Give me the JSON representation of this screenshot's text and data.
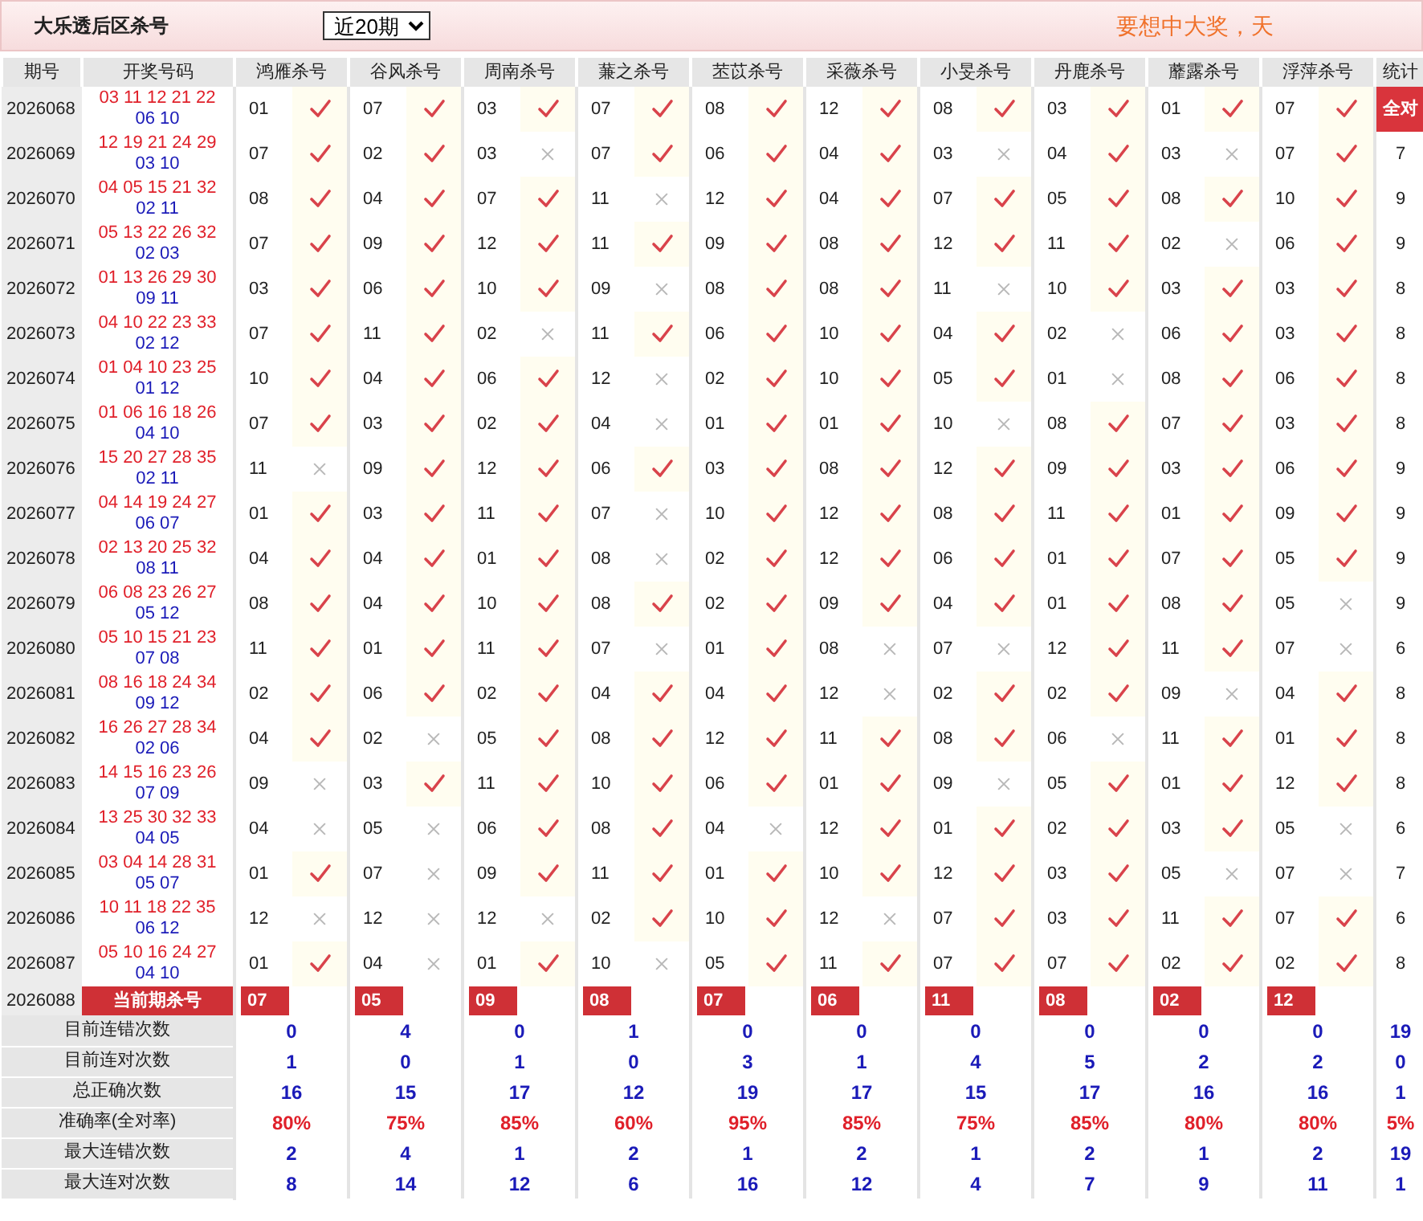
{
  "header": {
    "title": "大乐透后区杀号",
    "period_select": {
      "value": "近20期"
    },
    "slogan": "要想中大奖，天"
  },
  "table": {
    "columns": [
      "期号",
      "开奖号码",
      "鸿雁杀号",
      "谷风杀号",
      "周南杀号",
      "蒹之杀号",
      "苤苡杀号",
      "采薇杀号",
      "小旻杀号",
      "丹鹿杀号",
      "蘼露杀号",
      "浮萍杀号",
      "统计"
    ],
    "rows": [
      {
        "period": "2026068",
        "front": "03 11 12 21 22",
        "back": "06 10",
        "kills": [
          {
            "number": "01",
            "hit": true
          },
          {
            "number": "07",
            "hit": true
          },
          {
            "number": "03",
            "hit": true
          },
          {
            "number": "07",
            "hit": true
          },
          {
            "number": "08",
            "hit": true
          },
          {
            "number": "12",
            "hit": true
          },
          {
            "number": "08",
            "hit": true
          },
          {
            "number": "03",
            "hit": true
          },
          {
            "number": "01",
            "hit": true
          },
          {
            "number": "07",
            "hit": true
          }
        ],
        "total": {
          "text": "全对",
          "kind": "badge"
        }
      },
      {
        "period": "2026069",
        "front": "12 19 21 24 29",
        "back": "03 10",
        "kills": [
          {
            "number": "07",
            "hit": true
          },
          {
            "number": "02",
            "hit": true
          },
          {
            "number": "03",
            "hit": false
          },
          {
            "number": "07",
            "hit": true
          },
          {
            "number": "06",
            "hit": true
          },
          {
            "number": "04",
            "hit": true
          },
          {
            "number": "03",
            "hit": false
          },
          {
            "number": "04",
            "hit": true
          },
          {
            "number": "03",
            "hit": false
          },
          {
            "number": "07",
            "hit": true
          }
        ],
        "total": {
          "text": "7",
          "kind": "plain"
        }
      },
      {
        "period": "2026070",
        "front": "04 05 15 21 32",
        "back": "02 11",
        "kills": [
          {
            "number": "08",
            "hit": true
          },
          {
            "number": "04",
            "hit": true
          },
          {
            "number": "07",
            "hit": true
          },
          {
            "number": "11",
            "hit": false
          },
          {
            "number": "12",
            "hit": true
          },
          {
            "number": "04",
            "hit": true
          },
          {
            "number": "07",
            "hit": true
          },
          {
            "number": "05",
            "hit": true
          },
          {
            "number": "08",
            "hit": true
          },
          {
            "number": "10",
            "hit": true
          }
        ],
        "total": {
          "text": "9",
          "kind": "plain"
        }
      },
      {
        "period": "2026071",
        "front": "05 13 22 26 32",
        "back": "02 03",
        "kills": [
          {
            "number": "07",
            "hit": true
          },
          {
            "number": "09",
            "hit": true
          },
          {
            "number": "12",
            "hit": true
          },
          {
            "number": "11",
            "hit": true
          },
          {
            "number": "09",
            "hit": true
          },
          {
            "number": "08",
            "hit": true
          },
          {
            "number": "12",
            "hit": true
          },
          {
            "number": "11",
            "hit": true
          },
          {
            "number": "02",
            "hit": false
          },
          {
            "number": "06",
            "hit": true
          }
        ],
        "total": {
          "text": "9",
          "kind": "plain"
        }
      },
      {
        "period": "2026072",
        "front": "01 13 26 29 30",
        "back": "09 11",
        "kills": [
          {
            "number": "03",
            "hit": true
          },
          {
            "number": "06",
            "hit": true
          },
          {
            "number": "10",
            "hit": true
          },
          {
            "number": "09",
            "hit": false
          },
          {
            "number": "08",
            "hit": true
          },
          {
            "number": "08",
            "hit": true
          },
          {
            "number": "11",
            "hit": false
          },
          {
            "number": "10",
            "hit": true
          },
          {
            "number": "03",
            "hit": true
          },
          {
            "number": "03",
            "hit": true
          }
        ],
        "total": {
          "text": "8",
          "kind": "plain"
        }
      },
      {
        "period": "2026073",
        "front": "04 10 22 23 33",
        "back": "02 12",
        "kills": [
          {
            "number": "07",
            "hit": true
          },
          {
            "number": "11",
            "hit": true
          },
          {
            "number": "02",
            "hit": false
          },
          {
            "number": "11",
            "hit": true
          },
          {
            "number": "06",
            "hit": true
          },
          {
            "number": "10",
            "hit": true
          },
          {
            "number": "04",
            "hit": true
          },
          {
            "number": "02",
            "hit": false
          },
          {
            "number": "06",
            "hit": true
          },
          {
            "number": "03",
            "hit": true
          }
        ],
        "total": {
          "text": "8",
          "kind": "plain"
        }
      },
      {
        "period": "2026074",
        "front": "01 04 10 23 25",
        "back": "01 12",
        "kills": [
          {
            "number": "10",
            "hit": true
          },
          {
            "number": "04",
            "hit": true
          },
          {
            "number": "06",
            "hit": true
          },
          {
            "number": "12",
            "hit": false
          },
          {
            "number": "02",
            "hit": true
          },
          {
            "number": "10",
            "hit": true
          },
          {
            "number": "05",
            "hit": true
          },
          {
            "number": "01",
            "hit": false
          },
          {
            "number": "08",
            "hit": true
          },
          {
            "number": "06",
            "hit": true
          }
        ],
        "total": {
          "text": "8",
          "kind": "plain"
        }
      },
      {
        "period": "2026075",
        "front": "01 06 16 18 26",
        "back": "04 10",
        "kills": [
          {
            "number": "07",
            "hit": true
          },
          {
            "number": "03",
            "hit": true
          },
          {
            "number": "02",
            "hit": true
          },
          {
            "number": "04",
            "hit": false
          },
          {
            "number": "01",
            "hit": true
          },
          {
            "number": "01",
            "hit": true
          },
          {
            "number": "10",
            "hit": false
          },
          {
            "number": "08",
            "hit": true
          },
          {
            "number": "07",
            "hit": true
          },
          {
            "number": "03",
            "hit": true
          }
        ],
        "total": {
          "text": "8",
          "kind": "plain"
        }
      },
      {
        "period": "2026076",
        "front": "15 20 27 28 35",
        "back": "02 11",
        "kills": [
          {
            "number": "11",
            "hit": false
          },
          {
            "number": "09",
            "hit": true
          },
          {
            "number": "12",
            "hit": true
          },
          {
            "number": "06",
            "hit": true
          },
          {
            "number": "03",
            "hit": true
          },
          {
            "number": "08",
            "hit": true
          },
          {
            "number": "12",
            "hit": true
          },
          {
            "number": "09",
            "hit": true
          },
          {
            "number": "03",
            "hit": true
          },
          {
            "number": "06",
            "hit": true
          }
        ],
        "total": {
          "text": "9",
          "kind": "plain"
        }
      },
      {
        "period": "2026077",
        "front": "04 14 19 24 27",
        "back": "06 07",
        "kills": [
          {
            "number": "01",
            "hit": true
          },
          {
            "number": "03",
            "hit": true
          },
          {
            "number": "11",
            "hit": true
          },
          {
            "number": "07",
            "hit": false
          },
          {
            "number": "10",
            "hit": true
          },
          {
            "number": "12",
            "hit": true
          },
          {
            "number": "08",
            "hit": true
          },
          {
            "number": "11",
            "hit": true
          },
          {
            "number": "01",
            "hit": true
          },
          {
            "number": "09",
            "hit": true
          }
        ],
        "total": {
          "text": "9",
          "kind": "plain"
        }
      },
      {
        "period": "2026078",
        "front": "02 13 20 25 32",
        "back": "08 11",
        "kills": [
          {
            "number": "04",
            "hit": true
          },
          {
            "number": "04",
            "hit": true
          },
          {
            "number": "01",
            "hit": true
          },
          {
            "number": "08",
            "hit": false
          },
          {
            "number": "02",
            "hit": true
          },
          {
            "number": "12",
            "hit": true
          },
          {
            "number": "06",
            "hit": true
          },
          {
            "number": "01",
            "hit": true
          },
          {
            "number": "07",
            "hit": true
          },
          {
            "number": "05",
            "hit": true
          }
        ],
        "total": {
          "text": "9",
          "kind": "plain"
        }
      },
      {
        "period": "2026079",
        "front": "06 08 23 26 27",
        "back": "05 12",
        "kills": [
          {
            "number": "08",
            "hit": true
          },
          {
            "number": "04",
            "hit": true
          },
          {
            "number": "10",
            "hit": true
          },
          {
            "number": "08",
            "hit": true
          },
          {
            "number": "02",
            "hit": true
          },
          {
            "number": "09",
            "hit": true
          },
          {
            "number": "04",
            "hit": true
          },
          {
            "number": "01",
            "hit": true
          },
          {
            "number": "08",
            "hit": true
          },
          {
            "number": "05",
            "hit": false
          }
        ],
        "total": {
          "text": "9",
          "kind": "plain"
        }
      },
      {
        "period": "2026080",
        "front": "05 10 15 21 23",
        "back": "07 08",
        "kills": [
          {
            "number": "11",
            "hit": true
          },
          {
            "number": "01",
            "hit": true
          },
          {
            "number": "11",
            "hit": true
          },
          {
            "number": "07",
            "hit": false
          },
          {
            "number": "01",
            "hit": true
          },
          {
            "number": "08",
            "hit": false
          },
          {
            "number": "07",
            "hit": false
          },
          {
            "number": "12",
            "hit": true
          },
          {
            "number": "11",
            "hit": true
          },
          {
            "number": "07",
            "hit": false
          }
        ],
        "total": {
          "text": "6",
          "kind": "plain"
        }
      },
      {
        "period": "2026081",
        "front": "08 16 18 24 34",
        "back": "09 12",
        "kills": [
          {
            "number": "02",
            "hit": true
          },
          {
            "number": "06",
            "hit": true
          },
          {
            "number": "02",
            "hit": true
          },
          {
            "number": "04",
            "hit": true
          },
          {
            "number": "04",
            "hit": true
          },
          {
            "number": "12",
            "hit": false
          },
          {
            "number": "02",
            "hit": true
          },
          {
            "number": "02",
            "hit": true
          },
          {
            "number": "09",
            "hit": false
          },
          {
            "number": "04",
            "hit": true
          }
        ],
        "total": {
          "text": "8",
          "kind": "plain"
        }
      },
      {
        "period": "2026082",
        "front": "16 26 27 28 34",
        "back": "02 06",
        "kills": [
          {
            "number": "04",
            "hit": true
          },
          {
            "number": "02",
            "hit": false
          },
          {
            "number": "05",
            "hit": true
          },
          {
            "number": "08",
            "hit": true
          },
          {
            "number": "12",
            "hit": true
          },
          {
            "number": "11",
            "hit": true
          },
          {
            "number": "08",
            "hit": true
          },
          {
            "number": "06",
            "hit": false
          },
          {
            "number": "11",
            "hit": true
          },
          {
            "number": "01",
            "hit": true
          }
        ],
        "total": {
          "text": "8",
          "kind": "plain"
        }
      },
      {
        "period": "2026083",
        "front": "14 15 16 23 26",
        "back": "07 09",
        "kills": [
          {
            "number": "09",
            "hit": false
          },
          {
            "number": "03",
            "hit": true
          },
          {
            "number": "11",
            "hit": true
          },
          {
            "number": "10",
            "hit": true
          },
          {
            "number": "06",
            "hit": true
          },
          {
            "number": "01",
            "hit": true
          },
          {
            "number": "09",
            "hit": false
          },
          {
            "number": "05",
            "hit": true
          },
          {
            "number": "01",
            "hit": true
          },
          {
            "number": "12",
            "hit": true
          }
        ],
        "total": {
          "text": "8",
          "kind": "plain"
        }
      },
      {
        "period": "2026084",
        "front": "13 25 30 32 33",
        "back": "04 05",
        "kills": [
          {
            "number": "04",
            "hit": false
          },
          {
            "number": "05",
            "hit": false
          },
          {
            "number": "06",
            "hit": true
          },
          {
            "number": "08",
            "hit": true
          },
          {
            "number": "04",
            "hit": false
          },
          {
            "number": "12",
            "hit": true
          },
          {
            "number": "01",
            "hit": true
          },
          {
            "number": "02",
            "hit": true
          },
          {
            "number": "03",
            "hit": true
          },
          {
            "number": "05",
            "hit": false
          }
        ],
        "total": {
          "text": "6",
          "kind": "plain"
        }
      },
      {
        "period": "2026085",
        "front": "03 04 14 28 31",
        "back": "05 07",
        "kills": [
          {
            "number": "01",
            "hit": true
          },
          {
            "number": "07",
            "hit": false
          },
          {
            "number": "09",
            "hit": true
          },
          {
            "number": "11",
            "hit": true
          },
          {
            "number": "01",
            "hit": true
          },
          {
            "number": "10",
            "hit": true
          },
          {
            "number": "12",
            "hit": true
          },
          {
            "number": "03",
            "hit": true
          },
          {
            "number": "05",
            "hit": false
          },
          {
            "number": "07",
            "hit": false
          }
        ],
        "total": {
          "text": "7",
          "kind": "plain"
        }
      },
      {
        "period": "2026086",
        "front": "10 11 18 22 35",
        "back": "06 12",
        "kills": [
          {
            "number": "12",
            "hit": false
          },
          {
            "number": "12",
            "hit": false
          },
          {
            "number": "12",
            "hit": false
          },
          {
            "number": "02",
            "hit": true
          },
          {
            "number": "10",
            "hit": true
          },
          {
            "number": "12",
            "hit": false
          },
          {
            "number": "07",
            "hit": true
          },
          {
            "number": "03",
            "hit": true
          },
          {
            "number": "11",
            "hit": true
          },
          {
            "number": "07",
            "hit": true
          }
        ],
        "total": {
          "text": "6",
          "kind": "plain"
        }
      },
      {
        "period": "2026087",
        "front": "05 10 16 24 27",
        "back": "04 10",
        "kills": [
          {
            "number": "01",
            "hit": true
          },
          {
            "number": "04",
            "hit": false
          },
          {
            "number": "01",
            "hit": true
          },
          {
            "number": "10",
            "hit": false
          },
          {
            "number": "05",
            "hit": true
          },
          {
            "number": "11",
            "hit": true
          },
          {
            "number": "07",
            "hit": true
          },
          {
            "number": "07",
            "hit": true
          },
          {
            "number": "02",
            "hit": true
          },
          {
            "number": "02",
            "hit": true
          }
        ],
        "total": {
          "text": "8",
          "kind": "plain"
        }
      }
    ],
    "current": {
      "period": "2026088",
      "label": "当前期杀号",
      "kills": [
        "07",
        "05",
        "09",
        "08",
        "07",
        "06",
        "11",
        "08",
        "02",
        "12"
      ]
    },
    "stats": [
      {
        "label": "目前连错次数",
        "kind": "count",
        "values": [
          "0",
          "4",
          "0",
          "1",
          "0",
          "0",
          "0",
          "0",
          "0",
          "0",
          "19"
        ]
      },
      {
        "label": "目前连对次数",
        "kind": "count",
        "values": [
          "1",
          "0",
          "1",
          "0",
          "3",
          "1",
          "4",
          "5",
          "2",
          "2",
          "0"
        ]
      },
      {
        "label": "总正确次数",
        "kind": "count",
        "values": [
          "16",
          "15",
          "17",
          "12",
          "19",
          "17",
          "15",
          "17",
          "16",
          "16",
          "1"
        ]
      },
      {
        "label": "准确率(全对率)",
        "kind": "rate",
        "values": [
          "80%",
          "75%",
          "85%",
          "60%",
          "95%",
          "85%",
          "75%",
          "85%",
          "80%",
          "80%",
          "5%"
        ]
      },
      {
        "label": "最大连错次数",
        "kind": "count",
        "values": [
          "2",
          "4",
          "1",
          "2",
          "1",
          "2",
          "1",
          "2",
          "1",
          "2",
          "19"
        ]
      },
      {
        "label": "最大连对次数",
        "kind": "count",
        "values": [
          "8",
          "14",
          "12",
          "6",
          "16",
          "12",
          "4",
          "7",
          "9",
          "11",
          "1"
        ]
      }
    ]
  }
}
